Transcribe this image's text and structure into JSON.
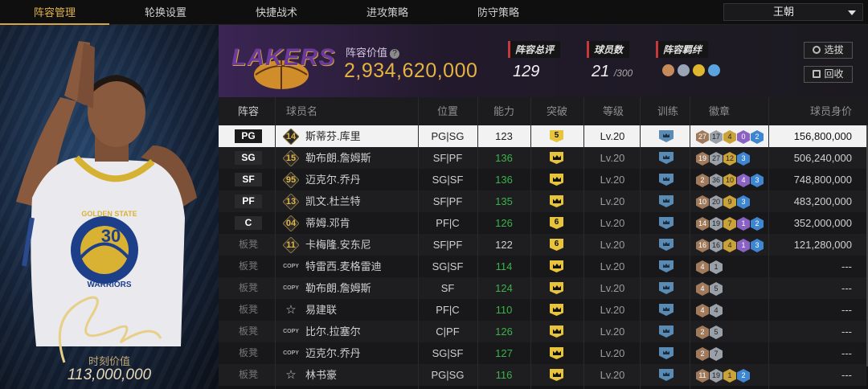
{
  "nav": {
    "tabs": [
      "阵容管理",
      "轮换设置",
      "快捷战术",
      "进攻策略",
      "防守策略"
    ],
    "team_select": "王朝"
  },
  "featured_player": {
    "jersey_number": "30",
    "team_text": "GOLDEN STATE",
    "team_text2": "WARRIORS",
    "value_label": "时刻价值",
    "value": "113,000,000"
  },
  "header": {
    "logo_text": "LAKERS",
    "value_label": "阵容价值",
    "value": "2,934,620,000",
    "stats": [
      {
        "label": "阵容总评",
        "value": "129"
      },
      {
        "label": "球员数",
        "value": "21",
        "sub": "/300"
      },
      {
        "label": "阵容羁绊"
      }
    ],
    "buttons": {
      "select": "选拔",
      "recycle": "回收"
    },
    "fetter_colors": [
      "#c78a5b",
      "#9aa5b8",
      "#e1b62f",
      "#5aa3df"
    ]
  },
  "table": {
    "columns": [
      "阵容",
      "球员名",
      "位置",
      "能力",
      "突破",
      "等级",
      "训练",
      "徽章",
      "球员身价"
    ],
    "rows": [
      {
        "slot": "PG",
        "num": "14",
        "name": "斯蒂芬.库里",
        "pos": "PG|SG",
        "ability": "123",
        "breakthrough": "5",
        "level": "Lv.20",
        "badges": [
          [
            "b",
            "27"
          ],
          [
            "s",
            "17"
          ],
          [
            "g",
            "4"
          ],
          [
            "p",
            "0"
          ],
          [
            "bl",
            "2"
          ]
        ],
        "value": "156,800,000"
      },
      {
        "slot": "SG",
        "num": "15",
        "name": "勒布朗.詹姆斯",
        "pos": "SF|PF",
        "ability": "136",
        "breakthrough": "crown",
        "level": "Lv.20",
        "badges": [
          [
            "b",
            "19"
          ],
          [
            "s",
            "27"
          ],
          [
            "g",
            "12"
          ],
          [
            "bl",
            "3"
          ]
        ],
        "value": "506,240,000"
      },
      {
        "slot": "SF",
        "num": "95",
        "name": "迈克尔.乔丹",
        "pos": "SG|SF",
        "ability": "136",
        "breakthrough": "crown",
        "level": "Lv.20",
        "badges": [
          [
            "b",
            "2"
          ],
          [
            "s",
            "36"
          ],
          [
            "g",
            "10"
          ],
          [
            "p",
            "4"
          ],
          [
            "bl",
            "3"
          ]
        ],
        "value": "748,800,000"
      },
      {
        "slot": "PF",
        "num": "13",
        "name": "凯文.杜兰特",
        "pos": "SF|PF",
        "ability": "135",
        "breakthrough": "crown",
        "level": "Lv.20",
        "badges": [
          [
            "b",
            "10"
          ],
          [
            "s",
            "20"
          ],
          [
            "g",
            "9"
          ],
          [
            "bl",
            "3"
          ]
        ],
        "value": "483,200,000"
      },
      {
        "slot": "C",
        "num": "04",
        "name": "蒂姆.邓肯",
        "pos": "PF|C",
        "ability": "126",
        "breakthrough": "6",
        "level": "Lv.20",
        "badges": [
          [
            "b",
            "14"
          ],
          [
            "s",
            "19"
          ],
          [
            "g",
            "7"
          ],
          [
            "p",
            "1"
          ],
          [
            "bl",
            "2"
          ]
        ],
        "value": "352,000,000"
      },
      {
        "slot": "板凳",
        "num": "11",
        "name": "卡梅隆.安东尼",
        "pos": "SF|PF",
        "ability": "122",
        "breakthrough": "6",
        "level": "Lv.20",
        "badges": [
          [
            "b",
            "16"
          ],
          [
            "s",
            "16"
          ],
          [
            "g",
            "4"
          ],
          [
            "p",
            "1"
          ],
          [
            "bl",
            "3"
          ]
        ],
        "value": "121,280,000"
      },
      {
        "slot": "板凳",
        "num": "COPY",
        "name": "特雷西.麦格雷迪",
        "pos": "SG|SF",
        "ability": "114",
        "breakthrough": "crown",
        "level": "Lv.20",
        "badges": [
          [
            "b",
            "4"
          ],
          [
            "s",
            "1"
          ]
        ],
        "value": "---"
      },
      {
        "slot": "板凳",
        "num": "COPY",
        "name": "勒布朗.詹姆斯",
        "pos": "SF",
        "ability": "124",
        "breakthrough": "crown",
        "level": "Lv.20",
        "badges": [
          [
            "b",
            "4"
          ],
          [
            "s",
            "5"
          ]
        ],
        "value": "---"
      },
      {
        "slot": "板凳",
        "num": "star",
        "name": "易建联",
        "pos": "PF|C",
        "ability": "110",
        "breakthrough": "crown",
        "level": "Lv.20",
        "badges": [
          [
            "b",
            "4"
          ],
          [
            "s",
            "4"
          ]
        ],
        "value": "---"
      },
      {
        "slot": "板凳",
        "num": "COPY",
        "name": "比尔.拉塞尔",
        "pos": "C|PF",
        "ability": "126",
        "breakthrough": "crown",
        "level": "Lv.20",
        "badges": [
          [
            "b",
            "2"
          ],
          [
            "s",
            "5"
          ]
        ],
        "value": "---"
      },
      {
        "slot": "板凳",
        "num": "COPY",
        "name": "迈克尔.乔丹",
        "pos": "SG|SF",
        "ability": "127",
        "breakthrough": "crown",
        "level": "Lv.20",
        "badges": [
          [
            "b",
            "2"
          ],
          [
            "s",
            "7"
          ]
        ],
        "value": "---"
      },
      {
        "slot": "板凳",
        "num": "star",
        "name": "林书豪",
        "pos": "PG|SG",
        "ability": "116",
        "breakthrough": "crown",
        "level": "Lv.20",
        "badges": [
          [
            "b",
            "11"
          ],
          [
            "s",
            "19"
          ],
          [
            "g",
            "1"
          ],
          [
            "bl",
            "2"
          ]
        ],
        "value": "---"
      }
    ]
  }
}
